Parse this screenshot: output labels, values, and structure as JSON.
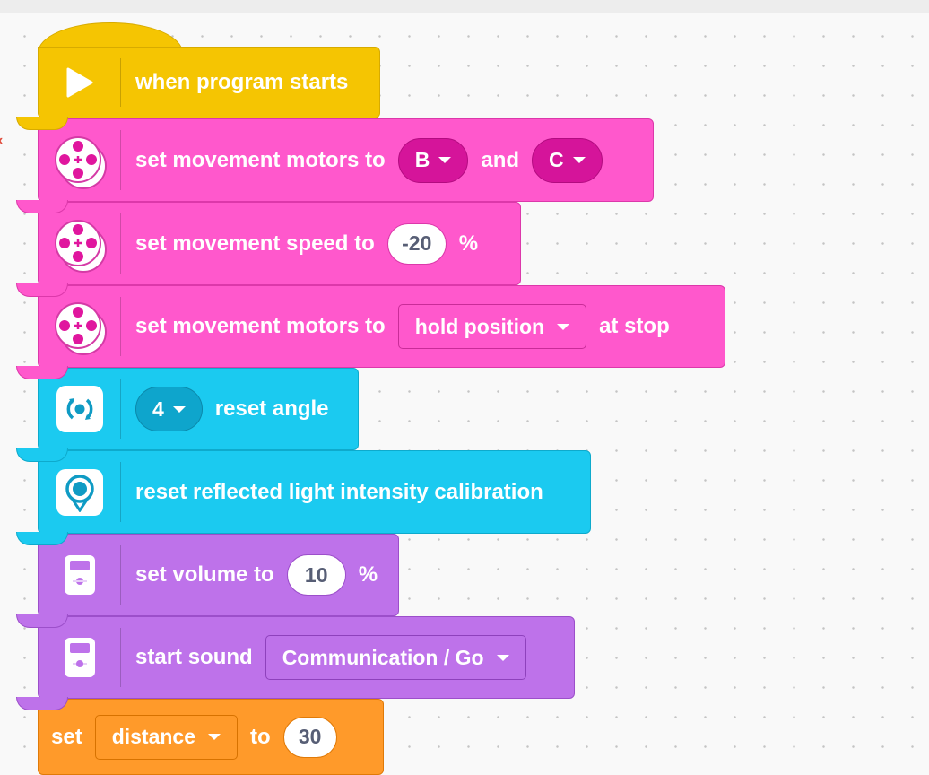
{
  "blocks": {
    "when_program_starts": {
      "label": "when program starts",
      "icon": "play-icon",
      "color": "#f5c502"
    },
    "set_motors": {
      "label_prefix": "set movement motors to",
      "motor_a": "B",
      "joiner": "and",
      "motor_b": "C",
      "icon": "motor-pair-icon",
      "color": "#ff58cc"
    },
    "set_speed": {
      "label_prefix": "set movement speed to",
      "value": "-20",
      "unit": "%",
      "icon": "motor-pair-icon"
    },
    "set_stop": {
      "label_prefix": "set movement motors to",
      "mode": "hold position",
      "suffix": "at stop",
      "icon": "motor-pair-icon"
    },
    "reset_angle": {
      "port": "4",
      "label": "reset angle",
      "icon": "gyro-icon",
      "color": "#1bcaf0"
    },
    "reset_light": {
      "label": "reset reflected light intensity calibration",
      "icon": "color-sensor-icon"
    },
    "set_volume": {
      "label_prefix": "set volume to",
      "value": "10",
      "unit": "%",
      "icon": "hub-icon",
      "color": "#be72ea"
    },
    "start_sound": {
      "label_prefix": "start sound",
      "sound": "Communication / Go",
      "icon": "hub-icon"
    },
    "set_variable": {
      "label_prefix": "set",
      "variable": "distance",
      "joiner": "to",
      "value": "30",
      "color": "#ff9a2a"
    }
  }
}
